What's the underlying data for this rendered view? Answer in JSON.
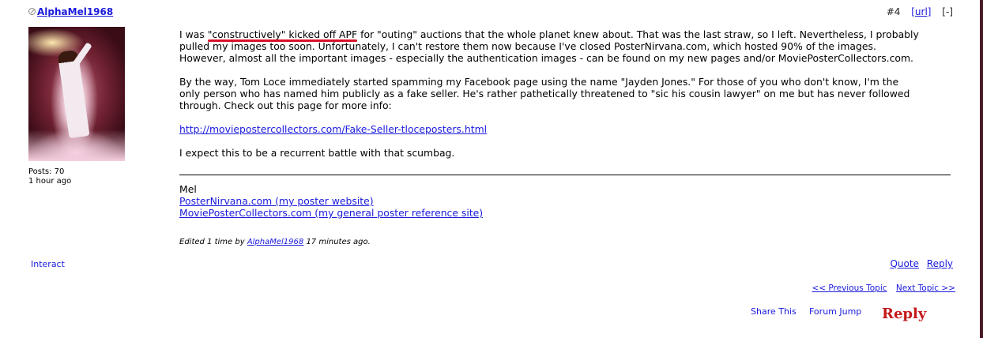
{
  "post": {
    "author": "AlphaMel1968",
    "number": "#4",
    "url_label": "[url]",
    "collapse_label": "[-]",
    "user_posts": "Posts: 70",
    "user_time": "1 hour ago",
    "p1_a": "I was ",
    "p1_highlight": "\"constructively\" kicked off APF",
    "p1_b": " for \"outing\" auctions that the whole planet knew about.  That was the last straw, so I left.  Nevertheless, I probably pulled my images too soon. Unfortunately, I can't restore them now because I've closed PosterNirvana.com, which hosted 90% of the images.   However, almost all the important images - especially the authentication images - can be found on my new pages and/or MoviePosterCollectors.com.",
    "p2": "By the way, Tom Loce immediately started spamming my Facebook page using the name \"Jayden Jones.\" For those of you who don't know, I'm the only person who has named him publicly as a fake seller. He's rather pathetically threatened to \"sic his cousin lawyer\" on me but has never followed through. Check out this page for more info:",
    "link": "http://moviepostercollectors.com/Fake-Seller-tloceposters.html",
    "p3": "I expect this to be a recurrent battle with that scumbag.",
    "sig_name": "Mel",
    "sig_link1": "PosterNirvana.com (my poster website)",
    "sig_link2": "MoviePosterCollectors.com (my general poster reference site)",
    "edited_prefix": "Edited 1 time by ",
    "edited_by": "AlphaMel1968",
    "edited_suffix": " 17 minutes ago."
  },
  "actions": {
    "interact": "Interact",
    "quote": "Quote",
    "reply": "Reply",
    "prev_topic": "<< Previous Topic",
    "next_topic": "Next Topic >>",
    "share": "Share This",
    "forum_jump": "Forum Jump",
    "reply_big": "Reply"
  },
  "colors": {
    "link": "#1a1adc",
    "highlight_underline": "#d8102a",
    "reply_button": "#c41a1a"
  }
}
